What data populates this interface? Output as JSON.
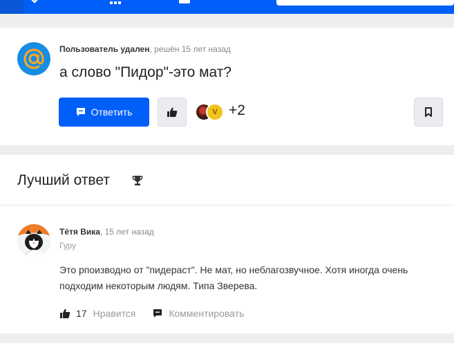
{
  "question": {
    "author": "Пользователь удален",
    "status": ", решён 15 лет назад",
    "title": "а слово \"Пидор\"-это мат?",
    "reply_label": "Ответить",
    "voters_extra": "+2",
    "voter_badge": "V"
  },
  "best_answer": {
    "section_title": "Лучший ответ",
    "author": "Тётя Вика",
    "time": ", 15 лет назад",
    "rank": "Гуру",
    "text": "Это рпоизводно от \"пидераст\". Не мат, но неблагозвучное. Хотя иногда очень подходим некоторым людям. Типа Зверева.",
    "likes": "17",
    "like_label": "Нравится",
    "comment_label": "Комментировать"
  },
  "colors": {
    "accent": "#005ff9",
    "avatar_blue": "#168de2",
    "avatar_orange": "#f5a623"
  },
  "icons": {
    "question_avatar": "at-sign-icon",
    "reply": "chat-bubble-icon",
    "like": "thumbs-up-icon",
    "bookmark": "bookmark-icon",
    "trophy": "trophy-icon",
    "comment": "comment-icon"
  }
}
